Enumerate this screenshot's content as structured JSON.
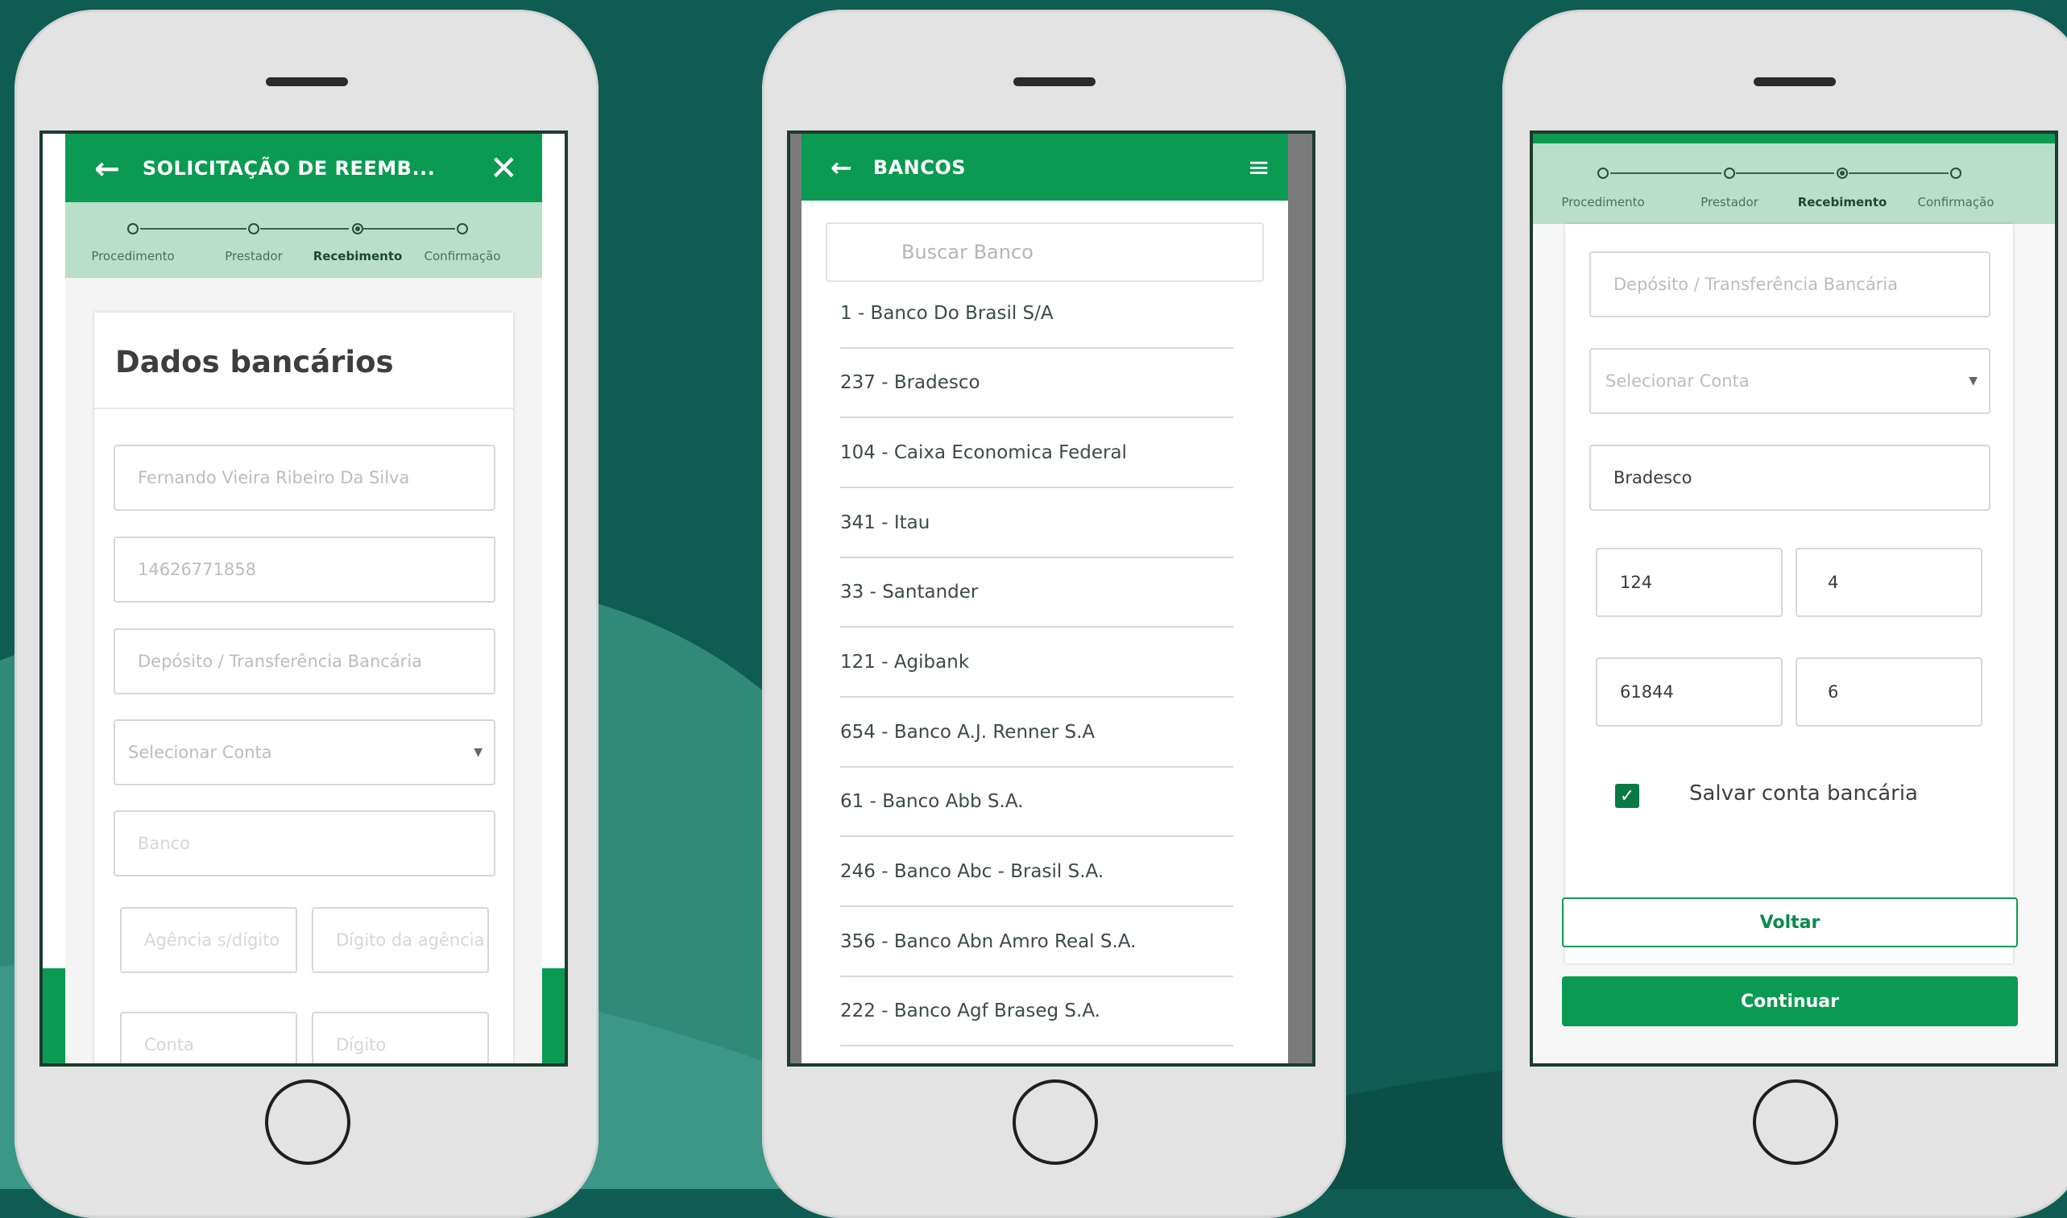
{
  "colors": {
    "background": "#0f5c52",
    "brand_green": "#0a9a52",
    "stepper_bg": "#b9dec9"
  },
  "phone1": {
    "back_icon": "arrow-left-icon",
    "title": "SOLICITAÇÃO DE REEMB...",
    "close_icon": "close-icon",
    "steps": [
      "Procedimento",
      "Prestador",
      "Recebimento",
      "Confirmação"
    ],
    "active_step": 2,
    "card_title": "Dados bancários",
    "fields": {
      "name": "Fernando Vieira Ribeiro Da Silva",
      "document": "14626771858",
      "method": "Depósito / Transferência Bancária",
      "account_select": "Selecionar Conta",
      "bank_placeholder": "Banco",
      "agency_placeholder": "Agência s/dígito",
      "agency_digit_placeholder": "Dígito da agência",
      "account_placeholder": "Conta",
      "account_digit_placeholder": "Dígito"
    }
  },
  "phone2": {
    "back_icon": "arrow-left-icon",
    "title": "BANCOS",
    "menu_icon": "hamburger-menu-icon",
    "search_placeholder": "Buscar Banco",
    "banks": [
      "1 - Banco Do Brasil S/A",
      "237 - Bradesco",
      "104 - Caixa Economica Federal",
      "341 - Itau",
      "33 - Santander",
      "121 - Agibank",
      "654 - Banco A.J. Renner S.A",
      "61 - Banco Abb S.A.",
      "246 - Banco Abc - Brasil S.A.",
      "356 - Banco Abn Amro Real S.A.",
      "222 - Banco Agf Braseg S.A."
    ]
  },
  "phone3": {
    "steps": [
      "Procedimento",
      "Prestador",
      "Recebimento",
      "Confirmação"
    ],
    "active_step": 2,
    "fields": {
      "method": "Depósito / Transferência Bancária",
      "account_select": "Selecionar Conta",
      "bank": "Bradesco",
      "agency": "124",
      "agency_digit": "4",
      "account": "61844",
      "account_digit": "6"
    },
    "save_account_label": "Salvar conta bancária",
    "save_account_checked": true,
    "back_button": "Voltar",
    "continue_button": "Continuar"
  }
}
